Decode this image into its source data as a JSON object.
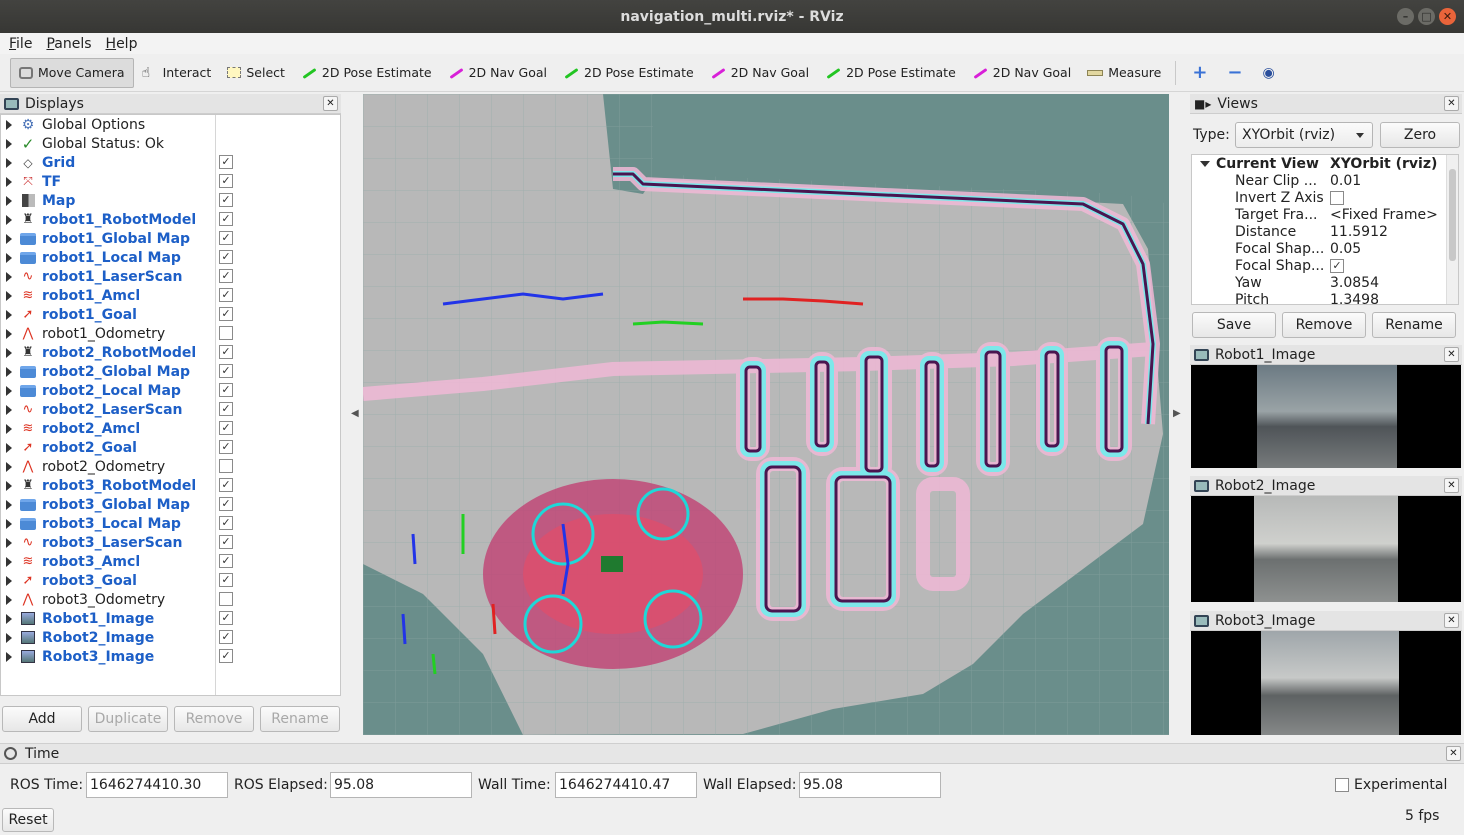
{
  "window": {
    "title": "navigation_multi.rviz* - RViz"
  },
  "menu": [
    "File",
    "Panels",
    "Help"
  ],
  "toolbar": {
    "tools": [
      {
        "label": "Move Camera",
        "icon": "move-camera-icon",
        "active": true
      },
      {
        "label": "Interact",
        "icon": "hand-icon"
      },
      {
        "label": "Select",
        "icon": "select-icon"
      },
      {
        "label": "2D Pose Estimate",
        "icon": "green-arrow-icon"
      },
      {
        "label": "2D Nav Goal",
        "icon": "magenta-arrow-icon"
      },
      {
        "label": "2D Pose Estimate",
        "icon": "green-arrow-icon"
      },
      {
        "label": "2D Nav Goal",
        "icon": "magenta-arrow-icon"
      },
      {
        "label": "2D Pose Estimate",
        "icon": "green-arrow-icon"
      },
      {
        "label": "2D Nav Goal",
        "icon": "magenta-arrow-icon"
      },
      {
        "label": "Measure",
        "icon": "ruler-icon"
      }
    ],
    "plus": "+",
    "minus": "−",
    "eye": "◉"
  },
  "displays": {
    "title": "Displays",
    "items": [
      {
        "label": "Global Options",
        "icon": "gear-icon",
        "bold": false,
        "checked": null
      },
      {
        "label": "Global Status: Ok",
        "icon": "check-icon",
        "bold": false,
        "checked": null
      },
      {
        "label": "Grid",
        "icon": "grid-icon",
        "bold": true,
        "checked": true
      },
      {
        "label": "TF",
        "icon": "tf-icon",
        "bold": true,
        "checked": true
      },
      {
        "label": "Map",
        "icon": "map-icon",
        "bold": true,
        "checked": true
      },
      {
        "label": "robot1_RobotModel",
        "icon": "robot-model-icon",
        "bold": true,
        "checked": true
      },
      {
        "label": "robot1_Global Map",
        "icon": "folder-icon",
        "bold": true,
        "checked": true
      },
      {
        "label": "robot1_Local Map",
        "icon": "folder-icon",
        "bold": true,
        "checked": true
      },
      {
        "label": "robot1_LaserScan",
        "icon": "laserscan-icon",
        "bold": true,
        "checked": true
      },
      {
        "label": "robot1_Amcl",
        "icon": "amcl-icon",
        "bold": true,
        "checked": true
      },
      {
        "label": "robot1_Goal",
        "icon": "goal-icon",
        "bold": true,
        "checked": true
      },
      {
        "label": "robot1_Odometry",
        "icon": "odometry-icon",
        "bold": false,
        "checked": false
      },
      {
        "label": "robot2_RobotModel",
        "icon": "robot-model-icon",
        "bold": true,
        "checked": true
      },
      {
        "label": "robot2_Global Map",
        "icon": "folder-icon",
        "bold": true,
        "checked": true
      },
      {
        "label": "robot2_Local Map",
        "icon": "folder-icon",
        "bold": true,
        "checked": true
      },
      {
        "label": "robot2_LaserScan",
        "icon": "laserscan-icon",
        "bold": true,
        "checked": true
      },
      {
        "label": "robot2_Amcl",
        "icon": "amcl-icon",
        "bold": true,
        "checked": true
      },
      {
        "label": "robot2_Goal",
        "icon": "goal-icon",
        "bold": true,
        "checked": true
      },
      {
        "label": "robot2_Odometry",
        "icon": "odometry-icon",
        "bold": false,
        "checked": false
      },
      {
        "label": "robot3_RobotModel",
        "icon": "robot-model-icon",
        "bold": true,
        "checked": true
      },
      {
        "label": "robot3_Global Map",
        "icon": "folder-icon",
        "bold": true,
        "checked": true
      },
      {
        "label": "robot3_Local Map",
        "icon": "folder-icon",
        "bold": true,
        "checked": true
      },
      {
        "label": "robot3_LaserScan",
        "icon": "laserscan-icon",
        "bold": true,
        "checked": true
      },
      {
        "label": "robot3_Amcl",
        "icon": "amcl-icon",
        "bold": true,
        "checked": true
      },
      {
        "label": "robot3_Goal",
        "icon": "goal-icon",
        "bold": true,
        "checked": true
      },
      {
        "label": "robot3_Odometry",
        "icon": "odometry-icon",
        "bold": false,
        "checked": false
      },
      {
        "label": "Robot1_Image",
        "icon": "image-icon",
        "bold": true,
        "checked": true
      },
      {
        "label": "Robot2_Image",
        "icon": "image-icon",
        "bold": true,
        "checked": true
      },
      {
        "label": "Robot3_Image",
        "icon": "image-icon",
        "bold": true,
        "checked": true
      }
    ],
    "buttons": {
      "add": "Add",
      "duplicate": "Duplicate",
      "remove": "Remove",
      "rename": "Rename"
    }
  },
  "views": {
    "title": "Views",
    "type_label": "Type:",
    "type_value": "XYOrbit (rviz)",
    "zero": "Zero",
    "current_view": {
      "key": "Current View",
      "value": "XYOrbit (rviz)"
    },
    "properties": [
      {
        "key": "Near Clip ...",
        "value": "0.01"
      },
      {
        "key": "Invert Z Axis",
        "value": "",
        "checkbox": false
      },
      {
        "key": "Target Fra...",
        "value": "<Fixed Frame>"
      },
      {
        "key": "Distance",
        "value": "11.5912"
      },
      {
        "key": "Focal Shap...",
        "value": "0.05"
      },
      {
        "key": "Focal Shap...",
        "value": "",
        "checkbox": true
      },
      {
        "key": "Yaw",
        "value": "3.0854"
      },
      {
        "key": "Pitch",
        "value": "1.3498"
      }
    ],
    "buttons": {
      "save": "Save",
      "remove": "Remove",
      "rename": "Rename"
    }
  },
  "images": [
    {
      "title": "Robot1_Image"
    },
    {
      "title": "Robot2_Image"
    },
    {
      "title": "Robot3_Image"
    }
  ],
  "time": {
    "title": "Time",
    "ros_time_label": "ROS Time:",
    "ros_time": "1646274410.30",
    "ros_elapsed_label": "ROS Elapsed:",
    "ros_elapsed": "95.08",
    "wall_time_label": "Wall Time:",
    "wall_time": "1646274410.47",
    "wall_elapsed_label": "Wall Elapsed:",
    "wall_elapsed": "95.08",
    "experimental": "Experimental",
    "reset": "Reset",
    "fps": "5 fps"
  },
  "colors": {
    "accent_blue": "#1d5fc7",
    "viewport_bg": "#6a8e8b",
    "free_space": "#b9b9b9",
    "obstacle": "#4a1550"
  }
}
